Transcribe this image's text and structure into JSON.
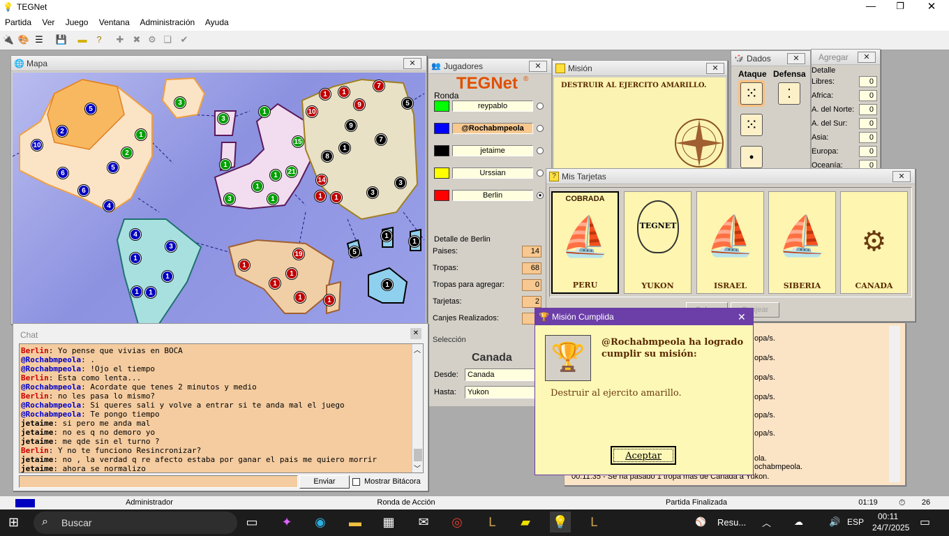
{
  "app": {
    "title": "TEGNet",
    "menu": [
      "Partida",
      "Ver",
      "Juego",
      "Ventana",
      "Administración",
      "Ayuda"
    ]
  },
  "windows": {
    "mapa": {
      "title": "Mapa"
    },
    "jugadores": {
      "title": "Jugadores",
      "logo": "TEGNet",
      "ronda_label": "Ronda",
      "players": [
        {
          "name": "reypablo",
          "color": "#00ff00",
          "active": false
        },
        {
          "name": "@Rochabmpeola",
          "color": "#0000ff",
          "active": false
        },
        {
          "name": "jetaime",
          "color": "#000000",
          "active": false
        },
        {
          "name": "Urssian",
          "color": "#ffff00",
          "active": false
        },
        {
          "name": "Berlin",
          "color": "#ff0000",
          "active": true
        }
      ],
      "detalle": {
        "title": "Detalle de Berlin",
        "rows": [
          {
            "label": "Paises:",
            "value": "14"
          },
          {
            "label": "Tropas:",
            "value": "68"
          },
          {
            "label": "Tropas para agregar:",
            "value": "0"
          },
          {
            "label": "Tarjetas:",
            "value": "2"
          },
          {
            "label": "Canjes Realizados:",
            "value": ""
          }
        ]
      },
      "seleccion": {
        "title": "Selección",
        "country": "Canada",
        "desde_label": "Desde:",
        "desde": "Canada",
        "hasta_label": "Hasta:",
        "hasta": "Yukon"
      }
    },
    "mision": {
      "title": "Misión",
      "text": "DESTRUIR AL EJERCITO AMARILLO."
    },
    "dados": {
      "title": "Dados",
      "ataque": "Ataque",
      "defensa": "Defensa"
    },
    "agregar": {
      "title": "Agregar",
      "detalle": "Detalle",
      "rows": [
        {
          "label": "Libres:",
          "value": "0"
        },
        {
          "label": "Africa:",
          "value": "0"
        },
        {
          "label": "A. del Norte:",
          "value": "0"
        },
        {
          "label": "A. del Sur:",
          "value": "0"
        },
        {
          "label": "Asia:",
          "value": "0"
        },
        {
          "label": "Europa:",
          "value": "0"
        },
        {
          "label": "Oceanía:",
          "value": "0"
        }
      ]
    },
    "tarjetas": {
      "title": "Mis Tarjetas",
      "cobrada": "COBRADA",
      "cards": [
        "PERU",
        "YUKON",
        "ISRAEL",
        "SIBERIA",
        "CANADA"
      ],
      "buttons": [
        "Cobrar",
        "Canjear"
      ]
    },
    "mision_cumplida": {
      "title": "Misión Cumplida",
      "heading": "@Rochabmpeola ha logrado cumplir su misión:",
      "text": "Destruir al ejercito amarillo.",
      "button": "Aceptar"
    },
    "log": {
      "lines": [
        "opa/s.",
        "opa/s.",
        "opa/s.",
        "opa/s.",
        "opa/s.",
        "opa/s.",
        "ola.",
        "ochabmpeola.",
        "00:11:35 - Se ha pasado 1 tropa mas de Canada a Yukon."
      ]
    }
  },
  "chat": {
    "title": "Chat",
    "send": "Enviar",
    "bitacora": "Mostrar Bitácora",
    "messages": [
      {
        "who": "Berlin",
        "color": "#cc0000",
        "text": "Yo pense que vivias en BOCA"
      },
      {
        "who": "@Rochabmpeola",
        "color": "#0000cc",
        "text": "."
      },
      {
        "who": "@Rochabmpeola",
        "color": "#0000cc",
        "text": "!Ojo el tiempo"
      },
      {
        "who": "Berlin",
        "color": "#cc0000",
        "text": "Esta como lenta..."
      },
      {
        "who": "@Rochabmpeola",
        "color": "#0000cc",
        "text": "Acordate que tenes 2 minutos y medio"
      },
      {
        "who": "Berlin",
        "color": "#cc0000",
        "text": "no les pasa lo mismo?"
      },
      {
        "who": "@Rochabmpeola",
        "color": "#0000cc",
        "text": "Si queres sali y volve a entrar si te anda mal el juego"
      },
      {
        "who": "@Rochabmpeola",
        "color": "#0000cc",
        "text": "Te pongo tiempo"
      },
      {
        "who": "jetaime",
        "color": "#000000",
        "text": "si pero me anda mal"
      },
      {
        "who": "jetaime",
        "color": "#000000",
        "text": "no es q no demoro yo"
      },
      {
        "who": "jetaime",
        "color": "#000000",
        "text": "me qde sin el turno ?"
      },
      {
        "who": "Berlin",
        "color": "#cc0000",
        "text": "Y no te funciono Resincronizar?"
      },
      {
        "who": "jetaime",
        "color": "#000000",
        "text": "no , la verdad q re afecto estaba por ganar el pais me quiero morrir"
      },
      {
        "who": "jetaime",
        "color": "#000000",
        "text": "ahora se normalizo"
      }
    ]
  },
  "status": {
    "user": "Administrador",
    "phase": "Ronda de Acción",
    "state": "Partida Finalizada",
    "time": "01:19",
    "count": "26"
  },
  "taskbar": {
    "search": "Buscar",
    "news": "Resu...",
    "lang": "ESP",
    "clock": "00:11",
    "date": "24/7/2025"
  },
  "map": {
    "troops": [
      {
        "n": "5",
        "c": "blue"
      },
      {
        "n": "2",
        "c": "blue"
      },
      {
        "n": "10",
        "c": "blue"
      },
      {
        "n": "6",
        "c": "blue"
      },
      {
        "n": "5",
        "c": "blue"
      },
      {
        "n": "6",
        "c": "blue"
      },
      {
        "n": "4",
        "c": "blue"
      },
      {
        "n": "3",
        "c": "green"
      },
      {
        "n": "1",
        "c": "green"
      },
      {
        "n": "2",
        "c": "green"
      },
      {
        "n": "3",
        "c": "green"
      },
      {
        "n": "1",
        "c": "green"
      },
      {
        "n": "1",
        "c": "green"
      },
      {
        "n": "15",
        "c": "green"
      },
      {
        "n": "1",
        "c": "green"
      },
      {
        "n": "21",
        "c": "green"
      },
      {
        "n": "1",
        "c": "green"
      },
      {
        "n": "1",
        "c": "green"
      },
      {
        "n": "3",
        "c": "green"
      },
      {
        "n": "1",
        "c": "red"
      },
      {
        "n": "1",
        "c": "red"
      },
      {
        "n": "7",
        "c": "red"
      },
      {
        "n": "10",
        "c": "red"
      },
      {
        "n": "9",
        "c": "red"
      },
      {
        "n": "14",
        "c": "red"
      },
      {
        "n": "1",
        "c": "red"
      },
      {
        "n": "1",
        "c": "red"
      },
      {
        "n": "19",
        "c": "red"
      },
      {
        "n": "1",
        "c": "red"
      },
      {
        "n": "1",
        "c": "red"
      },
      {
        "n": "1",
        "c": "red"
      },
      {
        "n": "1",
        "c": "red"
      },
      {
        "n": "1",
        "c": "red"
      },
      {
        "n": "5",
        "c": "black"
      },
      {
        "n": "9",
        "c": "black"
      },
      {
        "n": "1",
        "c": "black"
      },
      {
        "n": "7",
        "c": "black"
      },
      {
        "n": "8",
        "c": "black"
      },
      {
        "n": "3",
        "c": "black"
      },
      {
        "n": "3",
        "c": "black"
      },
      {
        "n": "5",
        "c": "black"
      },
      {
        "n": "1",
        "c": "black"
      },
      {
        "n": "1",
        "c": "black"
      },
      {
        "n": "1",
        "c": "black"
      },
      {
        "n": "4",
        "c": "blue"
      },
      {
        "n": "3",
        "c": "blue"
      },
      {
        "n": "1",
        "c": "blue"
      },
      {
        "n": "1",
        "c": "blue"
      },
      {
        "n": "1",
        "c": "blue"
      },
      {
        "n": "1",
        "c": "blue"
      }
    ]
  }
}
